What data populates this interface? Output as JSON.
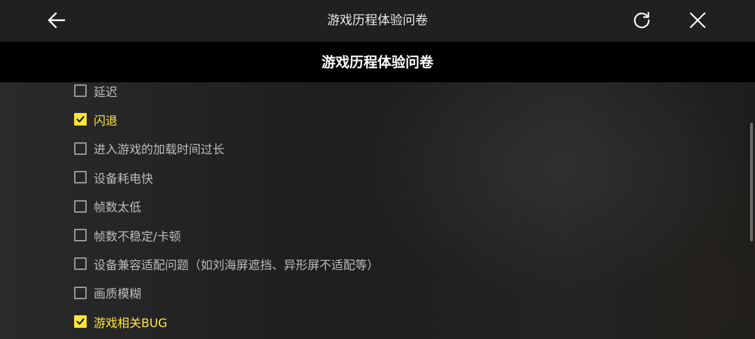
{
  "header": {
    "title": "游戏历程体验问卷",
    "back_icon": "arrow-left-icon",
    "refresh_icon": "refresh-icon",
    "close_icon": "close-icon"
  },
  "survey": {
    "title": "游戏历程体验问卷"
  },
  "options": [
    {
      "label": "延迟",
      "checked": false
    },
    {
      "label": "闪退",
      "checked": true
    },
    {
      "label": "进入游戏的加载时间过长",
      "checked": false
    },
    {
      "label": "设备耗电快",
      "checked": false
    },
    {
      "label": "帧数太低",
      "checked": false
    },
    {
      "label": "帧数不稳定/卡顿",
      "checked": false
    },
    {
      "label": "设备兼容适配问题（如刘海屏遮挡、异形屏不适配等）",
      "checked": false
    },
    {
      "label": "画质模糊",
      "checked": false
    },
    {
      "label": "游戏相关BUG",
      "checked": true
    }
  ],
  "colors": {
    "accent": "#ffe43b",
    "unchecked_text": "#bdbdbd",
    "header_bg": "#202021",
    "subheader_bg": "#000000"
  }
}
